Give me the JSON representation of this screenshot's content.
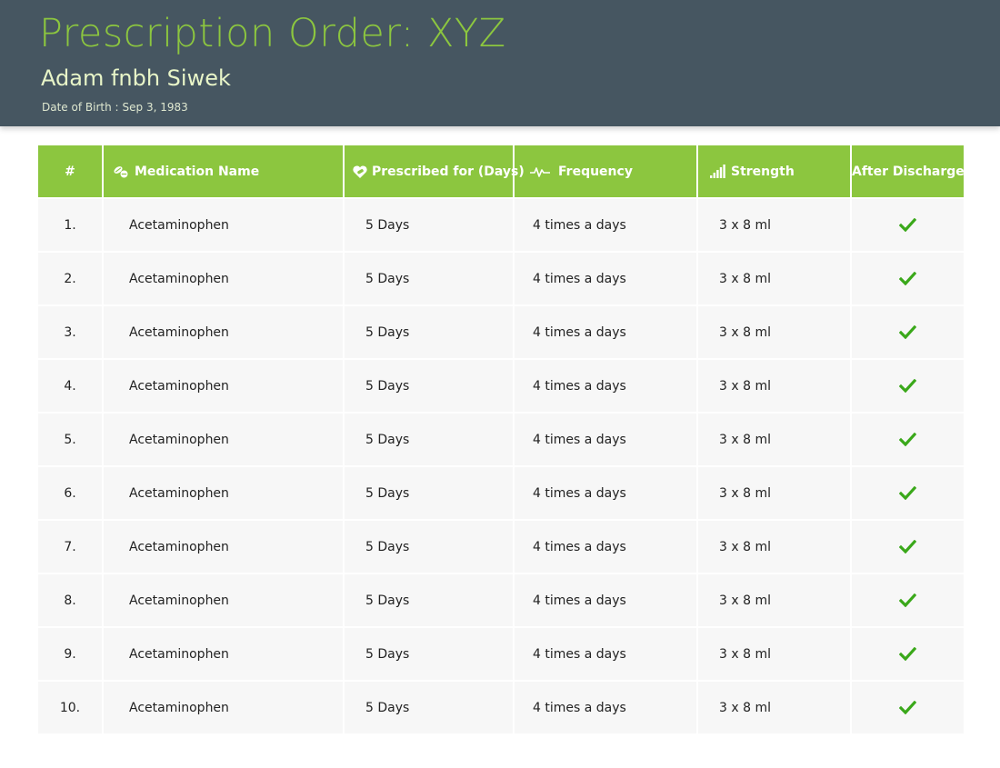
{
  "header": {
    "title": "Prescription Order: XYZ",
    "patient_name": "Adam fnbh Siwek",
    "dob_label": "Date of Birth :",
    "dob_value": "Sep 3, 1983"
  },
  "colors": {
    "header_bg": "#465661",
    "accent_green": "#8cc63f",
    "row_bg": "#f7f7f7",
    "check_green": "#3aa81a"
  },
  "table": {
    "columns": [
      {
        "label": "#",
        "icon": null
      },
      {
        "label": "Medication Name",
        "icon": "pills-icon"
      },
      {
        "label": "Prescribed for (Days)",
        "icon": "heart-pill-icon"
      },
      {
        "label": "Frequency",
        "icon": "pulse-icon"
      },
      {
        "label": "Strength",
        "icon": "signal-bars-icon"
      },
      {
        "label": "After Discharge",
        "icon": null
      }
    ],
    "rows": [
      {
        "num": "1.",
        "medication": "Acetaminophen",
        "days": "5 Days",
        "frequency": "4 times a days",
        "strength": "3 x 8 ml",
        "after_discharge": true
      },
      {
        "num": "2.",
        "medication": "Acetaminophen",
        "days": "5 Days",
        "frequency": "4 times a days",
        "strength": "3 x 8 ml",
        "after_discharge": true
      },
      {
        "num": "3.",
        "medication": "Acetaminophen",
        "days": "5 Days",
        "frequency": "4 times a days",
        "strength": "3 x 8 ml",
        "after_discharge": true
      },
      {
        "num": "4.",
        "medication": "Acetaminophen",
        "days": "5 Days",
        "frequency": "4 times a days",
        "strength": "3 x 8 ml",
        "after_discharge": true
      },
      {
        "num": "5.",
        "medication": "Acetaminophen",
        "days": "5 Days",
        "frequency": "4 times a days",
        "strength": "3 x 8 ml",
        "after_discharge": true
      },
      {
        "num": "6.",
        "medication": "Acetaminophen",
        "days": "5 Days",
        "frequency": "4 times a days",
        "strength": "3 x 8 ml",
        "after_discharge": true
      },
      {
        "num": "7.",
        "medication": "Acetaminophen",
        "days": "5 Days",
        "frequency": "4 times a days",
        "strength": "3 x 8 ml",
        "after_discharge": true
      },
      {
        "num": "8.",
        "medication": "Acetaminophen",
        "days": "5 Days",
        "frequency": "4 times a days",
        "strength": "3 x 8 ml",
        "after_discharge": true
      },
      {
        "num": "9.",
        "medication": "Acetaminophen",
        "days": "5 Days",
        "frequency": "4 times a days",
        "strength": "3 x 8 ml",
        "after_discharge": true
      },
      {
        "num": "10.",
        "medication": "Acetaminophen",
        "days": "5 Days",
        "frequency": "4 times a days",
        "strength": "3 x 8 ml",
        "after_discharge": true
      }
    ]
  }
}
